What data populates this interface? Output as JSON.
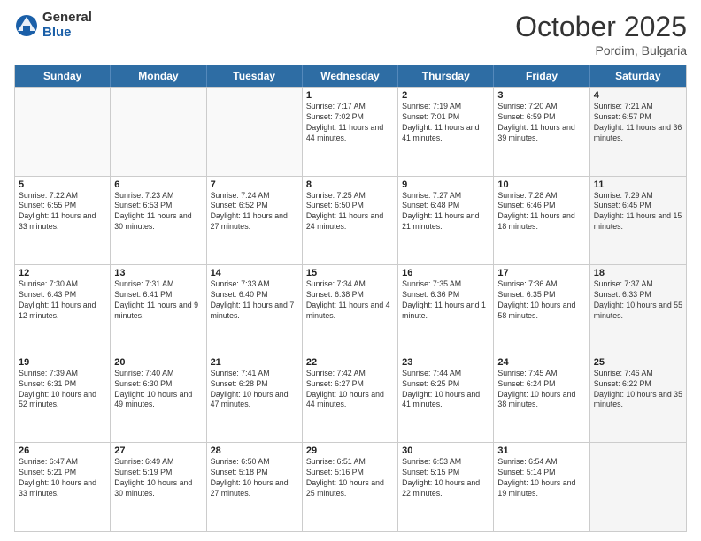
{
  "logo": {
    "general": "General",
    "blue": "Blue"
  },
  "title": "October 2025",
  "location": "Pordim, Bulgaria",
  "days_of_week": [
    "Sunday",
    "Monday",
    "Tuesday",
    "Wednesday",
    "Thursday",
    "Friday",
    "Saturday"
  ],
  "rows": [
    [
      {
        "day": "",
        "info": "",
        "empty": true
      },
      {
        "day": "",
        "info": "",
        "empty": true
      },
      {
        "day": "",
        "info": "",
        "empty": true
      },
      {
        "day": "1",
        "info": "Sunrise: 7:17 AM\nSunset: 7:02 PM\nDaylight: 11 hours and 44 minutes."
      },
      {
        "day": "2",
        "info": "Sunrise: 7:19 AM\nSunset: 7:01 PM\nDaylight: 11 hours and 41 minutes."
      },
      {
        "day": "3",
        "info": "Sunrise: 7:20 AM\nSunset: 6:59 PM\nDaylight: 11 hours and 39 minutes."
      },
      {
        "day": "4",
        "info": "Sunrise: 7:21 AM\nSunset: 6:57 PM\nDaylight: 11 hours and 36 minutes.",
        "shaded": true
      }
    ],
    [
      {
        "day": "5",
        "info": "Sunrise: 7:22 AM\nSunset: 6:55 PM\nDaylight: 11 hours and 33 minutes."
      },
      {
        "day": "6",
        "info": "Sunrise: 7:23 AM\nSunset: 6:53 PM\nDaylight: 11 hours and 30 minutes."
      },
      {
        "day": "7",
        "info": "Sunrise: 7:24 AM\nSunset: 6:52 PM\nDaylight: 11 hours and 27 minutes."
      },
      {
        "day": "8",
        "info": "Sunrise: 7:25 AM\nSunset: 6:50 PM\nDaylight: 11 hours and 24 minutes."
      },
      {
        "day": "9",
        "info": "Sunrise: 7:27 AM\nSunset: 6:48 PM\nDaylight: 11 hours and 21 minutes."
      },
      {
        "day": "10",
        "info": "Sunrise: 7:28 AM\nSunset: 6:46 PM\nDaylight: 11 hours and 18 minutes."
      },
      {
        "day": "11",
        "info": "Sunrise: 7:29 AM\nSunset: 6:45 PM\nDaylight: 11 hours and 15 minutes.",
        "shaded": true
      }
    ],
    [
      {
        "day": "12",
        "info": "Sunrise: 7:30 AM\nSunset: 6:43 PM\nDaylight: 11 hours and 12 minutes."
      },
      {
        "day": "13",
        "info": "Sunrise: 7:31 AM\nSunset: 6:41 PM\nDaylight: 11 hours and 9 minutes."
      },
      {
        "day": "14",
        "info": "Sunrise: 7:33 AM\nSunset: 6:40 PM\nDaylight: 11 hours and 7 minutes."
      },
      {
        "day": "15",
        "info": "Sunrise: 7:34 AM\nSunset: 6:38 PM\nDaylight: 11 hours and 4 minutes."
      },
      {
        "day": "16",
        "info": "Sunrise: 7:35 AM\nSunset: 6:36 PM\nDaylight: 11 hours and 1 minute."
      },
      {
        "day": "17",
        "info": "Sunrise: 7:36 AM\nSunset: 6:35 PM\nDaylight: 10 hours and 58 minutes."
      },
      {
        "day": "18",
        "info": "Sunrise: 7:37 AM\nSunset: 6:33 PM\nDaylight: 10 hours and 55 minutes.",
        "shaded": true
      }
    ],
    [
      {
        "day": "19",
        "info": "Sunrise: 7:39 AM\nSunset: 6:31 PM\nDaylight: 10 hours and 52 minutes."
      },
      {
        "day": "20",
        "info": "Sunrise: 7:40 AM\nSunset: 6:30 PM\nDaylight: 10 hours and 49 minutes."
      },
      {
        "day": "21",
        "info": "Sunrise: 7:41 AM\nSunset: 6:28 PM\nDaylight: 10 hours and 47 minutes."
      },
      {
        "day": "22",
        "info": "Sunrise: 7:42 AM\nSunset: 6:27 PM\nDaylight: 10 hours and 44 minutes."
      },
      {
        "day": "23",
        "info": "Sunrise: 7:44 AM\nSunset: 6:25 PM\nDaylight: 10 hours and 41 minutes."
      },
      {
        "day": "24",
        "info": "Sunrise: 7:45 AM\nSunset: 6:24 PM\nDaylight: 10 hours and 38 minutes."
      },
      {
        "day": "25",
        "info": "Sunrise: 7:46 AM\nSunset: 6:22 PM\nDaylight: 10 hours and 35 minutes.",
        "shaded": true
      }
    ],
    [
      {
        "day": "26",
        "info": "Sunrise: 6:47 AM\nSunset: 5:21 PM\nDaylight: 10 hours and 33 minutes."
      },
      {
        "day": "27",
        "info": "Sunrise: 6:49 AM\nSunset: 5:19 PM\nDaylight: 10 hours and 30 minutes."
      },
      {
        "day": "28",
        "info": "Sunrise: 6:50 AM\nSunset: 5:18 PM\nDaylight: 10 hours and 27 minutes."
      },
      {
        "day": "29",
        "info": "Sunrise: 6:51 AM\nSunset: 5:16 PM\nDaylight: 10 hours and 25 minutes."
      },
      {
        "day": "30",
        "info": "Sunrise: 6:53 AM\nSunset: 5:15 PM\nDaylight: 10 hours and 22 minutes."
      },
      {
        "day": "31",
        "info": "Sunrise: 6:54 AM\nSunset: 5:14 PM\nDaylight: 10 hours and 19 minutes."
      },
      {
        "day": "",
        "info": "",
        "empty": true,
        "shaded": true
      }
    ]
  ]
}
